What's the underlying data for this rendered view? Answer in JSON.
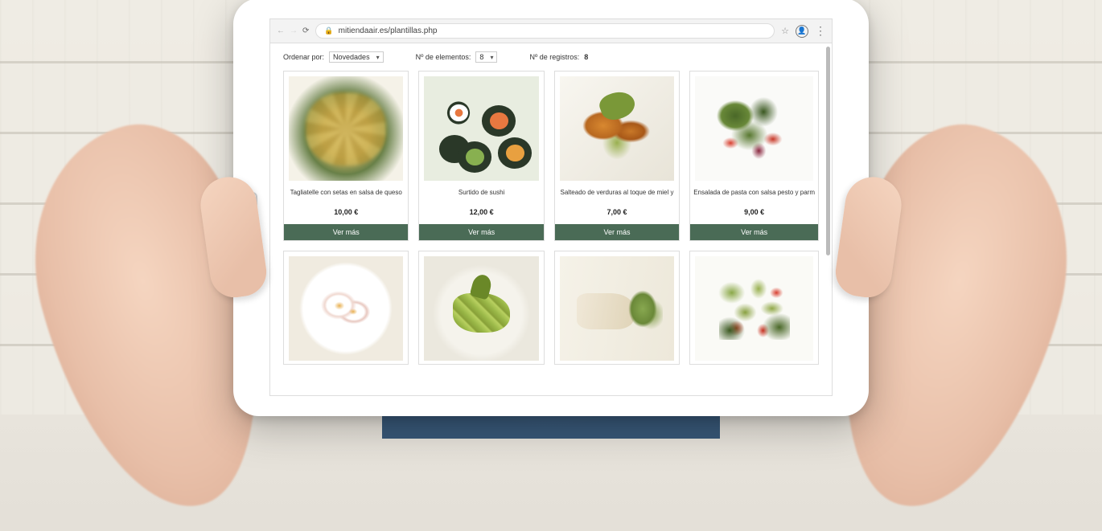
{
  "browser": {
    "url": "mitiendaair.es/plantillas.php"
  },
  "filters": {
    "sort_label": "Ordenar por:",
    "sort_value": "Novedades",
    "items_label": "Nº de elementos:",
    "items_value": "8",
    "records_label": "Nº de registros:",
    "records_value": "8"
  },
  "button_label": "Ver más",
  "products": [
    {
      "title": "Tagliatelle con setas en salsa de queso",
      "price": "10,00 €",
      "img": "food-pasta"
    },
    {
      "title": "Surtido de sushi",
      "price": "12,00 €",
      "img": "food-sushi"
    },
    {
      "title": "Salteado de verduras al toque de miel y",
      "price": "7,00 €",
      "img": "food-veggies"
    },
    {
      "title": "Ensalada de pasta con salsa pesto y parm",
      "price": "9,00 €",
      "img": "food-salad"
    },
    {
      "title": "",
      "price": "",
      "img": "food-eggs"
    },
    {
      "title": "",
      "price": "",
      "img": "food-zucchini"
    },
    {
      "title": "",
      "price": "",
      "img": "food-fish"
    },
    {
      "title": "",
      "price": "",
      "img": "food-farfalle"
    }
  ]
}
